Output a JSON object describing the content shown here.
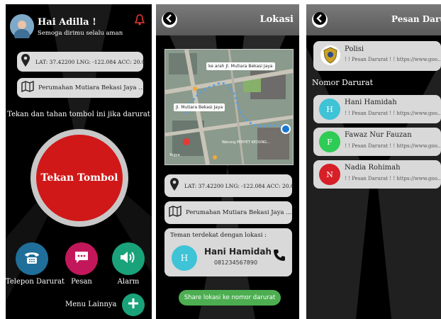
{
  "screen1": {
    "greeting": "Hai Adilla !",
    "subgreeting": "Semoga dirimu selalu aman",
    "latlng": "LAT: 37.42200 LNG: -122.084 ACC: 20.0",
    "address": "Perumahan Mutiara Bekasi Jaya ...",
    "instruction": "Tekan dan tahan tombol ini jika darurat",
    "big_button": "Tekan Tombol",
    "actions": [
      {
        "label": "Telepon Darurat",
        "icon": "phone-icon",
        "color": "#1f6f9a"
      },
      {
        "label": "Pesan",
        "icon": "message-icon",
        "color": "#c2185b"
      },
      {
        "label": "Alarm",
        "icon": "speaker-icon",
        "color": "#1aa37a"
      }
    ],
    "more_label": "Menu Lainnya"
  },
  "screen2": {
    "title": "Lokasi",
    "map_labels": [
      "ke arah Jl. Mutiara Bekasi Jaya",
      "Jl. Mutiara Bekasi Jaya",
      "Warung PENYET KEDUNG...",
      "Yogya"
    ],
    "latlng": "LAT: 37.42200 LNG: -122.084 ACC: 20.0",
    "address": "Perumahan Mutiara Bekasi Jaya ...",
    "nearby_title": "Teman terdekat dengan lokasi :",
    "nearby_initial": "H",
    "nearby_name": "Hani Hamidah",
    "nearby_phone": "081234567890",
    "share_button": "Share lokasi ke nomor darurat"
  },
  "screen3": {
    "title": "Pesan Darura",
    "police": {
      "name": "Polisi",
      "message": "! ! Pesan Darurat ! ! https://www.goo..."
    },
    "section": "Nomor Darurat",
    "contacts": [
      {
        "initial": "H",
        "name": "Hani Hamidah",
        "message": "! ! Pesan Darurat ! ! https://www.goo...",
        "color": "#3fc3d6"
      },
      {
        "initial": "F",
        "name": "Fawaz Nur Fauzan",
        "message": "! ! Pesan Darurat ! ! https://www.goo...",
        "color": "#2ecc55"
      },
      {
        "initial": "N",
        "name": "Nadia Rohimah",
        "message": "! ! Pesan Darurat ! ! https://www.goo...",
        "color": "#d61f26"
      }
    ]
  },
  "colors": {
    "red_button": "#d01818",
    "share_green": "#4cae50",
    "background": "#000000"
  }
}
